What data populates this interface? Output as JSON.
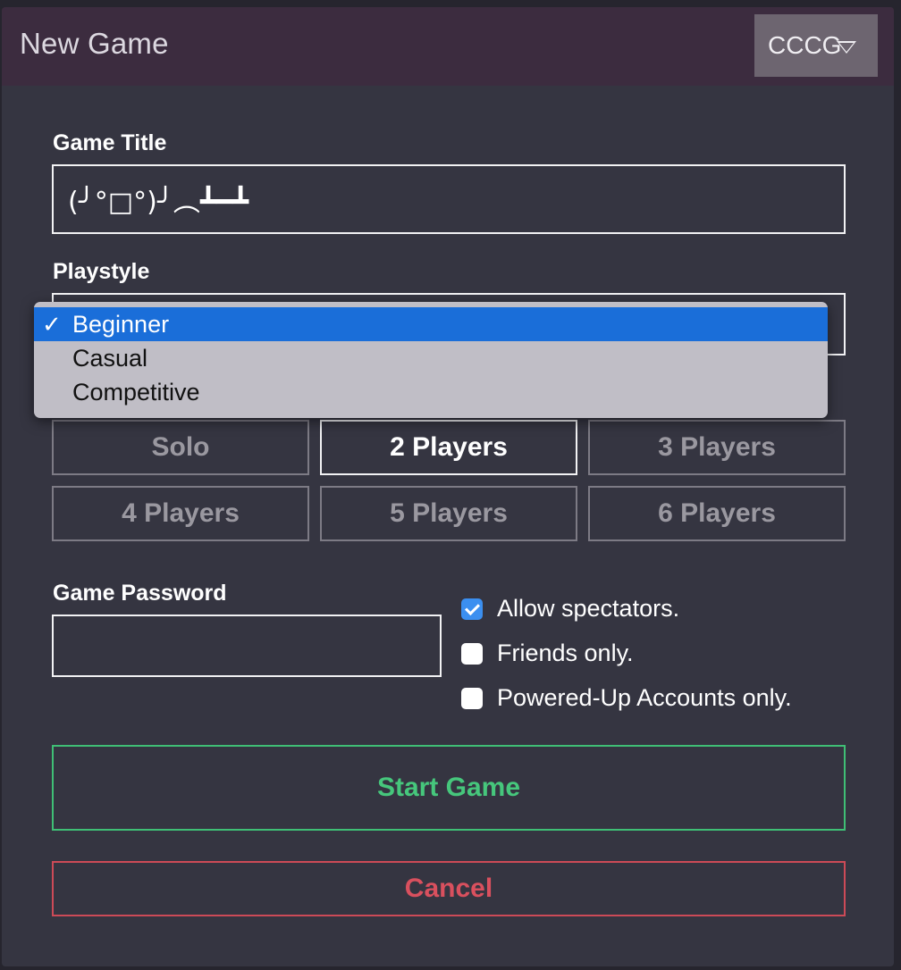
{
  "header": {
    "title": "New Game",
    "format_value": "CCCG"
  },
  "game_title": {
    "label": "Game Title",
    "value": "(╯°□°)╯︵┻━┻"
  },
  "playstyle": {
    "label": "Playstyle",
    "options": [
      {
        "label": "Beginner",
        "selected": true
      },
      {
        "label": "Casual",
        "selected": false
      },
      {
        "label": "Competitive",
        "selected": false
      }
    ],
    "check_mark": "✓"
  },
  "players": {
    "options": [
      "Solo",
      "2 Players",
      "3 Players",
      "4 Players",
      "5 Players",
      "6 Players"
    ],
    "selected": "2 Players"
  },
  "password": {
    "label": "Game Password",
    "value": ""
  },
  "options": [
    {
      "label": "Allow spectators.",
      "checked": true
    },
    {
      "label": "Friends only.",
      "checked": false
    },
    {
      "label": "Powered-Up Accounts only.",
      "checked": false
    }
  ],
  "actions": {
    "start_label": "Start Game",
    "cancel_label": "Cancel"
  },
  "colors": {
    "start": "#46c77c",
    "cancel": "#d9505e",
    "dropdown_highlight": "#1a6ed9",
    "checkbox_checked": "#3b8ff0"
  }
}
